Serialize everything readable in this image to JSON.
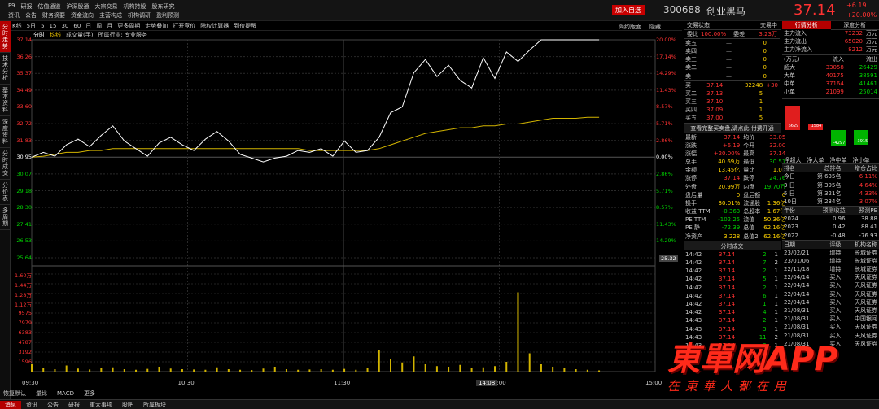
{
  "header": {
    "menu_row1": [
      "F9",
      "研报",
      "估值通道",
      "沪深股通",
      "大宗交易",
      "机构持股",
      "股东研究"
    ],
    "menu_row2": [
      "资讯",
      "公告",
      "财务摘要",
      "资金流向",
      "主营构成",
      "机构调研",
      "盈利预测"
    ],
    "add_watch": "加入自选",
    "code": "300688",
    "name": "创业黑马",
    "price": "37.14",
    "change": "+6.19",
    "pct": "+20.00%"
  },
  "leftbar": [
    "分时走势",
    "技术分析",
    "基本资料",
    "深度资料",
    "分时成交",
    "分价表",
    "多周期"
  ],
  "chart_toolbar": {
    "items": [
      "K线",
      "5日",
      "5",
      "15",
      "30",
      "60",
      "日",
      "周",
      "月",
      "更多周期",
      "走势叠加",
      "打开竞价",
      "除权计算器",
      "到价提醒"
    ],
    "right": [
      "简约版面",
      "隐藏"
    ]
  },
  "legend": {
    "minute": "分时",
    "avg": "均线",
    "vol": "成交量(手)",
    "industry": "所属行业: 专业服务"
  },
  "price_axis": {
    "left": [
      "37.14",
      "36.26",
      "35.37",
      "34.49",
      "33.60",
      "32.72",
      "31.83",
      "30.95",
      "30.07",
      "29.18",
      "28.30",
      "27.41",
      "26.53",
      "25.64"
    ],
    "right": [
      "20.00%",
      "17.14%",
      "14.29%",
      "11.43%",
      "8.57%",
      "5.71%",
      "2.86%",
      "0.00%",
      "2.86%",
      "5.71%",
      "8.57%",
      "11.43%",
      "14.29%"
    ],
    "low_tag": "25.32"
  },
  "vol_axis": [
    "1.60万",
    "1.44万",
    "1.28万",
    "1.12万",
    "9575",
    "7979",
    "6383",
    "4787",
    "3192",
    "1596"
  ],
  "time_axis": [
    "09:30",
    "10:30",
    "11:30",
    "14:00",
    "15:00"
  ],
  "cursor_time": "14:08",
  "bottom_tabs": [
    "恢复默认",
    "量比",
    "MACD",
    "更多"
  ],
  "footer_tabs": [
    "消息",
    "资讯",
    "公告",
    "研报",
    "重大事项",
    "股吧",
    "所属板块"
  ],
  "chart_data": {
    "type": "line",
    "x_range": [
      "09:30",
      "15:00"
    ],
    "ylim": [
      25.64,
      37.14
    ],
    "prev_close": 30.95,
    "price_series": [
      30.95,
      31.2,
      31.0,
      31.6,
      31.9,
      31.5,
      32.1,
      32.6,
      31.8,
      31.4,
      31.0,
      31.7,
      32.0,
      31.6,
      31.3,
      31.9,
      32.3,
      31.8,
      31.1,
      30.9,
      30.7,
      30.9,
      31.0,
      31.3,
      31.2,
      31.4,
      31.0,
      31.8,
      31.2,
      31.3,
      32.0,
      33.3,
      33.6,
      35.4,
      36.1,
      35.2,
      35.8,
      35.0,
      34.6,
      36.2,
      35.1,
      36.5,
      36.0,
      36.6,
      37.14,
      37.14,
      37.14,
      37.14,
      37.14,
      37.14
    ],
    "avg_series": [
      30.95,
      31.0,
      31.1,
      31.2,
      31.2,
      31.3,
      31.3,
      31.4,
      31.4,
      31.4,
      31.4,
      31.4,
      31.4,
      31.4,
      31.4,
      31.4,
      31.4,
      31.4,
      31.4,
      31.4,
      31.4,
      31.4,
      31.4,
      31.4,
      31.3,
      31.3,
      31.3,
      31.3,
      31.3,
      31.3,
      31.4,
      31.6,
      31.8,
      32.0,
      32.2,
      32.3,
      32.4,
      32.5,
      32.5,
      32.6,
      32.6,
      32.7,
      32.7,
      32.8,
      32.9,
      33.0,
      33.0,
      33.0,
      33.05,
      33.05
    ],
    "vol_series": [
      1200,
      600,
      400,
      1000,
      500,
      350,
      600,
      700,
      400,
      300,
      450,
      800,
      500,
      400,
      350,
      300,
      700,
      400,
      300,
      250,
      500,
      800,
      400,
      300,
      350,
      400,
      300,
      450,
      300,
      600,
      3500,
      2000,
      1500,
      2500,
      1200,
      900,
      800,
      1100,
      600,
      700,
      900,
      1600,
      13000,
      3000,
      1200,
      800,
      600,
      400,
      300,
      200
    ]
  },
  "right_panel": {
    "tabs": [
      "交易状态",
      "交易中"
    ],
    "weibi": {
      "label": "委比",
      "value": "100.00%",
      "label2": "委差",
      "value2": "3.23万"
    },
    "asks": [
      {
        "l": "卖五",
        "p": "—",
        "v": "0"
      },
      {
        "l": "卖四",
        "p": "—",
        "v": "0"
      },
      {
        "l": "卖三",
        "p": "—",
        "v": "0"
      },
      {
        "l": "卖二",
        "p": "—",
        "v": "0"
      },
      {
        "l": "卖一",
        "p": "—",
        "v": "0"
      }
    ],
    "bids": [
      {
        "l": "买一",
        "p": "37.14",
        "v": "32248",
        "d": "+30"
      },
      {
        "l": "买二",
        "p": "37.13",
        "v": "5",
        "d": ""
      },
      {
        "l": "买三",
        "p": "37.10",
        "v": "1",
        "d": ""
      },
      {
        "l": "买四",
        "p": "37.09",
        "v": "1",
        "d": ""
      },
      {
        "l": "买五",
        "p": "37.00",
        "v": "5",
        "d": ""
      }
    ],
    "full_quote_link": "查看完整买卖盘,请点此 付费开通",
    "stats": [
      [
        "最新",
        "37.14",
        "均价",
        "33.05"
      ],
      [
        "涨跌",
        "+6.19",
        "今开",
        "32.00"
      ],
      [
        "涨幅",
        "+20.00%",
        "最高",
        "37.14"
      ],
      [
        "总手",
        "40.69万",
        "最低",
        "30.51"
      ],
      [
        "金额",
        "13.45亿",
        "量比",
        "1.05"
      ],
      [
        "涨停",
        "37.14",
        "跌停",
        "24.76"
      ],
      [
        "外盘",
        "20.99万",
        "内盘",
        "19.70万"
      ],
      [
        "盘后量",
        "0",
        "盘后额",
        "0"
      ],
      [
        "换手",
        "30.01%",
        "流通股",
        "1.36亿"
      ],
      [
        "收益 TTM",
        "-0.363",
        "总股本",
        "1.67亿"
      ],
      [
        "PE TTM",
        "-102.25",
        "流值",
        "50.36亿"
      ],
      [
        "PE 静",
        "-72.39",
        "总值",
        "62.16亿"
      ],
      [
        "净资产",
        "3.228",
        "总值2",
        "62.16亿"
      ]
    ],
    "trades_title": "分时成交",
    "trades": [
      [
        "14:42",
        "37.14",
        "2",
        "1"
      ],
      [
        "14:42",
        "37.14",
        "7",
        "2"
      ],
      [
        "14:42",
        "37.14",
        "2",
        "1"
      ],
      [
        "14:42",
        "37.14",
        "5",
        "1"
      ],
      [
        "14:42",
        "37.14",
        "2",
        "1"
      ],
      [
        "14:42",
        "37.14",
        "6",
        "1"
      ],
      [
        "14:42",
        "37.14",
        "1",
        "1"
      ],
      [
        "14:42",
        "37.14",
        "4",
        "1"
      ],
      [
        "14:43",
        "37.14",
        "2",
        "1"
      ],
      [
        "14:43",
        "37.14",
        "3",
        "1"
      ],
      [
        "14:43",
        "37.14",
        "11",
        "2"
      ],
      [
        "14:43",
        "37.14",
        "3",
        "1"
      ]
    ]
  },
  "far_right": {
    "tabs": [
      "行情分析",
      "深度分析"
    ],
    "flows": [
      [
        "主力流入",
        "73232",
        "万元"
      ],
      [
        "主力流出",
        "65020",
        "万元"
      ],
      [
        "主力净流入",
        "8212",
        "万元"
      ]
    ],
    "flow_head": [
      "(万元)",
      "流入",
      "流出"
    ],
    "flow_rows": [
      [
        "超大",
        "33058",
        "26429"
      ],
      [
        "大单",
        "40175",
        "38591"
      ],
      [
        "中单",
        "37164",
        "41461"
      ],
      [
        "小单",
        "21099",
        "25014"
      ]
    ],
    "bars": [
      {
        "label": "净超大",
        "value": "6629"
      },
      {
        "label": "净大单",
        "value": "1584"
      },
      {
        "label": "净中单",
        "value": "-4297"
      },
      {
        "label": "净小单",
        "value": "-3915"
      }
    ],
    "rank_head": [
      "排名",
      "总排名",
      "增仓占比"
    ],
    "ranks": [
      [
        "今日",
        "第 635名",
        "6.11%"
      ],
      [
        "3 日",
        "第 395名",
        "4.64%"
      ],
      [
        "5 日",
        "第 321名",
        "4.33%"
      ],
      [
        "10日",
        "第 234名",
        "3.07%"
      ]
    ],
    "eps_head": [
      "年份",
      "预测收益",
      "预测PE"
    ],
    "eps": [
      [
        "2024",
        "0.96",
        "38.88"
      ],
      [
        "2023",
        "0.42",
        "88.41"
      ],
      [
        "2022",
        "-0.48",
        "-76.93"
      ]
    ],
    "rating_head": [
      "日期",
      "评级",
      "机构名称"
    ],
    "ratings": [
      [
        "23/02/21",
        "增持",
        "长城证券"
      ],
      [
        "23/01/06",
        "增持",
        "长城证券"
      ],
      [
        "22/11/18",
        "增持",
        "长城证券"
      ],
      [
        "22/04/14",
        "买入",
        "天风证券"
      ],
      [
        "22/04/14",
        "买入",
        "天风证券"
      ],
      [
        "22/04/14",
        "买入",
        "天风证券"
      ],
      [
        "22/04/14",
        "买入",
        "天风证券"
      ],
      [
        "21/08/31",
        "买入",
        "天风证券"
      ],
      [
        "21/08/31",
        "买入",
        "中国银河"
      ],
      [
        "21/08/31",
        "买入",
        "天风证券"
      ],
      [
        "21/08/31",
        "买入",
        "天风证券"
      ],
      [
        "21/08/31",
        "买入",
        "天风证券"
      ]
    ],
    "bottom_tabs": [
      "分笔",
      "K线",
      "分时",
      "财"
    ]
  },
  "watermark": {
    "main": "東單网APP",
    "sub": "在 東 華 人 都 在 用"
  }
}
